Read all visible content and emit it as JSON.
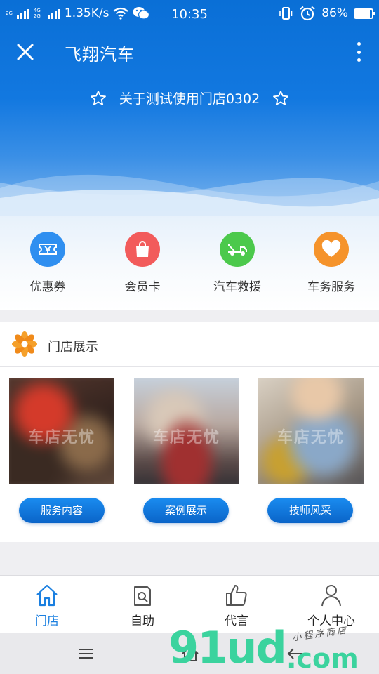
{
  "status_bar": {
    "network_tag_top": "2G",
    "network_tag_bottom": "4G 2G",
    "speed": "1.35K/s",
    "time": "10:35",
    "battery": "86%",
    "battery_level": 0.86
  },
  "nav": {
    "title": "飞翔汽车"
  },
  "store": {
    "name": "关于测试使用门店0302"
  },
  "quick_menu": [
    {
      "label": "优惠券",
      "icon": "ticket-icon",
      "color": "#2f8ff0"
    },
    {
      "label": "会员卡",
      "icon": "shopping-bag-icon",
      "color": "#f25b5b"
    },
    {
      "label": "汽车救援",
      "icon": "tow-truck-icon",
      "color": "#4cc94c"
    },
    {
      "label": "车务服务",
      "icon": "heart-icon",
      "color": "#f5932b"
    }
  ],
  "showcase": {
    "title": "门店展示",
    "watermark": "车店无忧",
    "items": [
      {
        "label": "服务内容"
      },
      {
        "label": "案例展示"
      },
      {
        "label": "技师风采"
      }
    ]
  },
  "tabbar": [
    {
      "label": "门店",
      "icon": "home-icon",
      "active": true
    },
    {
      "label": "自助",
      "icon": "self-service-icon",
      "active": false
    },
    {
      "label": "代言",
      "icon": "thumbs-up-icon",
      "active": false
    },
    {
      "label": "个人中心",
      "icon": "person-icon",
      "active": false
    }
  ],
  "watermark_logo": {
    "main": "91ud",
    "suffix": ".com",
    "tagline": "小程序商店"
  },
  "colors": {
    "primary": "#1278e0",
    "tab_active": "#1a7fe0"
  }
}
